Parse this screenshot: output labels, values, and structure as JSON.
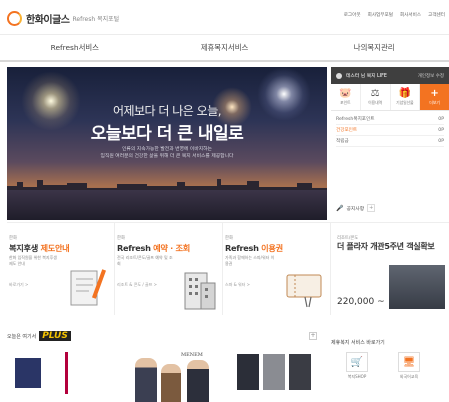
{
  "header": {
    "brand": "한화이글스",
    "sub": "Refresh 복지포털",
    "util_links": [
      "로그아웃",
      "회사업무포털",
      "회사서비스",
      "고객센터"
    ]
  },
  "gnb": [
    "Refresh서비스",
    "제휴복지서비스",
    "나의복지관리"
  ],
  "hero": {
    "line1": "어제보다 더 나은 오늘,",
    "line2": "오늘보다 더 큰 내일로",
    "desc1": "인류의 지속가능한 발전과 번영에 이바지하는",
    "desc2": "임직원 여러분의 건강한 삶을 위해 더 큰 복지 서비스를 제공합니다"
  },
  "panel": {
    "user": "테스터 님 복지 LIFE",
    "edit": "개인정보 수정",
    "quick": [
      {
        "icon": "piggy-bank-icon",
        "glyph": "🐷",
        "label": "포인트"
      },
      {
        "icon": "scale-icon",
        "glyph": "⚖",
        "label": "이용내역"
      },
      {
        "icon": "gift-icon",
        "glyph": "🎁",
        "label": "기념일선물"
      },
      {
        "icon": "add-icon",
        "glyph": "+",
        "label": "더보기"
      }
    ],
    "points": [
      {
        "label": "Refresh복지포인트",
        "value": "0P"
      },
      {
        "label": "건강포인트",
        "value": "0P"
      },
      {
        "label": "적립금",
        "value": "0P"
      }
    ],
    "notice": "공지사항"
  },
  "cards": [
    {
      "small": "한화",
      "big_a": "복지후생 ",
      "big_b": "제도안내",
      "desc": "한화 임직원을 위한 복지후생제도 안내",
      "more": "바로가기 >"
    },
    {
      "small": "한화",
      "big_a": "Refresh ",
      "big_b": "예약 · 조회",
      "desc": "전국 리조트/콘도/골프 예약 및 조회",
      "more": "리조트 & 콘도 / 골프 >"
    },
    {
      "small": "한화",
      "big_a": "Refresh ",
      "big_b": "이용권",
      "desc": "가족과 함께하는 스파/워터 이용권",
      "more": "스파 & 워터 >"
    },
    {
      "small": "리조트/콘도",
      "big": "더 플라자 개관5주년 객실확보",
      "price": "220,000 ~"
    }
  ],
  "bottom": {
    "plus_title": "오늘은 여기서",
    "plus_logo": "PLUS",
    "partner_title": "제휴복지 서비스 바로가기",
    "partners": [
      {
        "icon": "shop-icon",
        "glyph": "🛒",
        "label": "복지SHOP"
      },
      {
        "icon": "education-icon",
        "glyph": "🖥",
        "label": "외국어교육"
      }
    ],
    "brand_tag": "MENEM"
  },
  "colors": {
    "accent": "#f37321",
    "dark": "#3f3f3f"
  }
}
